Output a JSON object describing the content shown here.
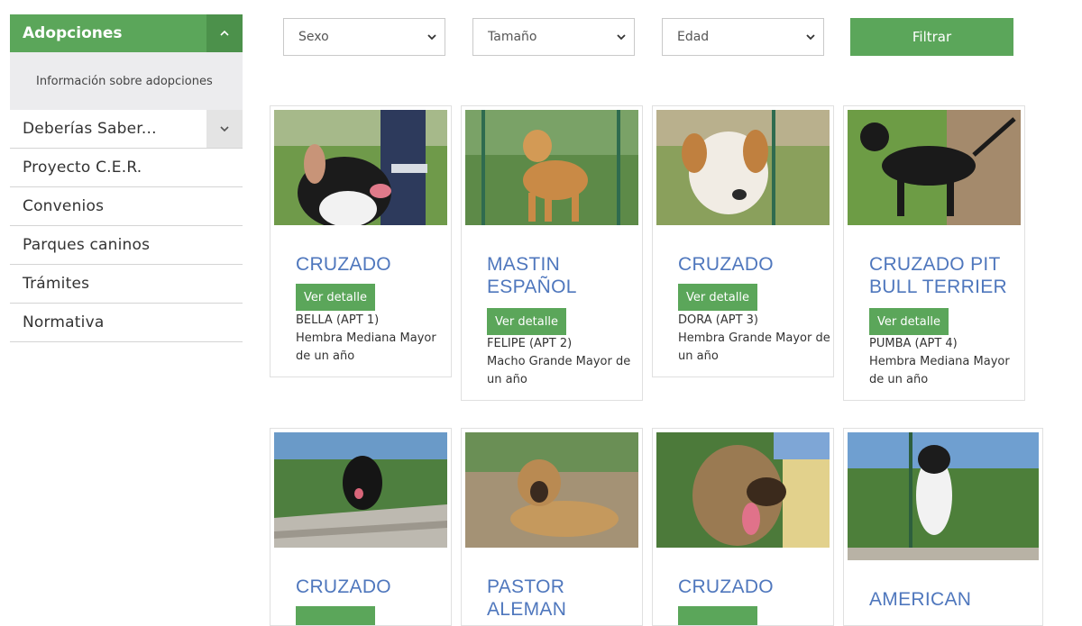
{
  "sidebar": {
    "active_section": "Adopciones",
    "sub_items": [
      "Información sobre adopciones"
    ],
    "items": [
      {
        "label": "Deberías Saber...",
        "expandable": true
      },
      {
        "label": "Proyecto C.E.R.",
        "expandable": false
      },
      {
        "label": "Convenios",
        "expandable": false
      },
      {
        "label": "Parques caninos",
        "expandable": false
      },
      {
        "label": "Trámites",
        "expandable": false
      },
      {
        "label": "Normativa",
        "expandable": false
      }
    ]
  },
  "filters": {
    "sexo": "Sexo",
    "tamano": "Tamaño",
    "edad": "Edad",
    "button": "Filtrar"
  },
  "cards": [
    {
      "breed": "CRUZADO",
      "button": "Ver detalle",
      "name": "BELLA (APT 1)",
      "details": "Hembra Mediana Mayor de un año"
    },
    {
      "breed": "MASTIN ESPAÑOL",
      "button": "Ver detalle",
      "name": "FELIPE (APT 2)",
      "details": "Macho Grande Mayor de un año"
    },
    {
      "breed": "CRUZADO",
      "button": "Ver detalle",
      "name": "DORA (APT 3)",
      "details": "Hembra Grande Mayor de un año"
    },
    {
      "breed": "CRUZADO PIT BULL TERRIER",
      "button": "Ver detalle",
      "name": "PUMBA (APT 4)",
      "details": "Hembra Mediana Mayor de un año"
    },
    {
      "breed": "CRUZADO",
      "button": "",
      "name": "",
      "details": ""
    },
    {
      "breed": "PASTOR ALEMAN",
      "button": "",
      "name": "",
      "details": ""
    },
    {
      "breed": "CRUZADO",
      "button": "",
      "name": "",
      "details": ""
    },
    {
      "breed": "AMERICAN",
      "button": "",
      "name": "",
      "details": ""
    }
  ],
  "colors": {
    "accent_green": "#5ba65a",
    "breed_blue": "#4f77bd"
  }
}
